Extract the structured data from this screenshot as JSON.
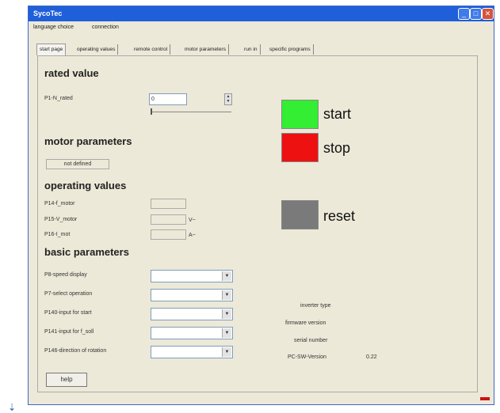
{
  "window": {
    "title": "SycoTec"
  },
  "menu": {
    "items": [
      "language choice",
      "connection"
    ]
  },
  "tabs": [
    "start page",
    "operating values",
    "remote control",
    "motor parameters",
    "run in",
    "specific programs"
  ],
  "rated_value": {
    "heading": "rated value",
    "label": "P1-N_rated",
    "value": "0",
    "slider_level": 0
  },
  "motor_parameters": {
    "heading": "motor parameters",
    "status": "not defined"
  },
  "operating_values": {
    "heading": "operating values",
    "rows": [
      {
        "label": "P14-f_motor",
        "value": "",
        "unit": ""
      },
      {
        "label": "P15-V_motor",
        "value": "",
        "unit": "V~"
      },
      {
        "label": "P16-I_mot",
        "value": "",
        "unit": "A~"
      }
    ]
  },
  "basic_parameters": {
    "heading": "basic parameters",
    "rows": [
      {
        "label": "P8-speed display",
        "value": ""
      },
      {
        "label": "P7-select operation",
        "value": ""
      },
      {
        "label": "P140-input for start",
        "value": ""
      },
      {
        "label": "P141-input for f_soll",
        "value": ""
      },
      {
        "label": "P146-direction of rotation",
        "value": ""
      }
    ]
  },
  "controls": {
    "start": {
      "label": "start",
      "color": "#33ee33"
    },
    "stop": {
      "label": "stop",
      "color": "#ee1111"
    },
    "reset": {
      "label": "reset",
      "color": "#7a7a7a"
    }
  },
  "info": {
    "inverter_type": {
      "label": "inverter type",
      "value": ""
    },
    "firmware_version": {
      "label": "firmware version",
      "value": ""
    },
    "serial_number": {
      "label": "serial number",
      "value": ""
    },
    "pc_sw_version": {
      "label": "PC-SW-Version",
      "value": "0.22"
    }
  },
  "help_button": "help",
  "colors": {
    "titlebar": "#1f5fd9",
    "status_indicator": "#cc1111"
  }
}
